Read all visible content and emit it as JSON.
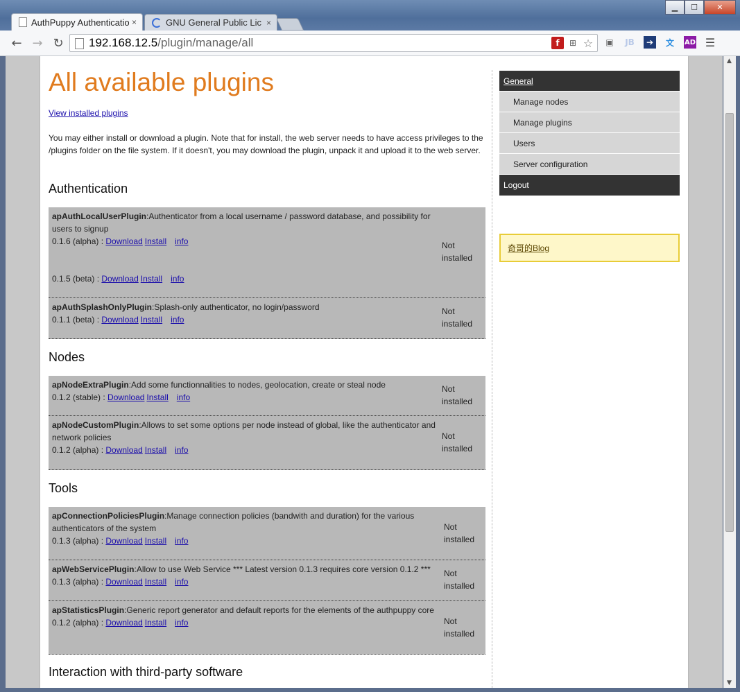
{
  "browser": {
    "tabs": [
      {
        "title": "AuthPuppy Authenticatio",
        "close": "×"
      },
      {
        "title": "GNU General Public Lic",
        "close": "×"
      }
    ],
    "url_host": "192.168.12.5",
    "url_path": "/plugin/manage/all",
    "nav": {
      "back": "←",
      "forward": "→",
      "reload": "↻"
    },
    "window": {
      "minimize": "▁",
      "maximize": "☐",
      "close": "✕"
    }
  },
  "page": {
    "title": "All available plugins",
    "view_installed_link": "View installed plugins",
    "intro": "You may either install or download a plugin. Note that for install, the web server needs to have access privileges to the /plugins folder on the file system. If it doesn't, you may download the plugin, unpack it and upload it to the web server.",
    "sections": [
      {
        "heading": "Authentication",
        "plugins": [
          {
            "name": "apAuthLocalUserPlugin",
            "desc": ":Authenticator from a local username / password database, and possibility for users to signup",
            "versions": [
              {
                "label": "0.1.6 (alpha) : ",
                "download": "Download",
                "install": "Install",
                "info": "info"
              },
              {
                "label": "0.1.5 (beta) : ",
                "download": "Download",
                "install": "Install",
                "info": "info"
              }
            ],
            "status": "Not installed"
          },
          {
            "name": "apAuthSplashOnlyPlugin",
            "desc": ":Splash-only authenticator, no login/password",
            "versions": [
              {
                "label": "0.1.1 (beta) : ",
                "download": "Download",
                "install": "Install",
                "info": "info"
              }
            ],
            "status": "Not installed"
          }
        ]
      },
      {
        "heading": "Nodes",
        "plugins": [
          {
            "name": "apNodeExtraPlugin",
            "desc": ":Add some functionnalities to nodes, geolocation, create or steal node",
            "versions": [
              {
                "label": "0.1.2 (stable) : ",
                "download": "Download",
                "install": "Install",
                "info": "info"
              }
            ],
            "status": "Not installed"
          },
          {
            "name": "apNodeCustomPlugin",
            "desc": ":Allows to set some options per node instead of global, like the authenticator and network policies",
            "versions": [
              {
                "label": "0.1.2 (alpha) : ",
                "download": "Download",
                "install": "Install",
                "info": "info"
              }
            ],
            "status": "Not installed"
          }
        ]
      },
      {
        "heading": "Tools",
        "plugins": [
          {
            "name": "apConnectionPoliciesPlugin",
            "desc": ":Manage connection policies (bandwith and duration) for the various authenticators of the system",
            "versions": [
              {
                "label": "0.1.3 (alpha) : ",
                "download": "Download",
                "install": "Install",
                "info": "info"
              }
            ],
            "status": "Not installed"
          },
          {
            "name": "apWebServicePlugin",
            "desc": ":Allow to use Web Service *** Latest version 0.1.3 requires core version 0.1.2 ***",
            "versions": [
              {
                "label": "0.1.3 (alpha) : ",
                "download": "Download",
                "install": "Install",
                "info": "info"
              }
            ],
            "status": "Not installed"
          },
          {
            "name": "apStatisticsPlugin",
            "desc": ":Generic report generator and default reports for the elements of the authpuppy core",
            "versions": [
              {
                "label": "0.1.2 (alpha) : ",
                "download": "Download",
                "install": "Install",
                "info": "info"
              }
            ],
            "status": "Not installed"
          }
        ]
      },
      {
        "heading": "Interaction with third-party software",
        "plugins": []
      }
    ]
  },
  "sidebar": {
    "general": "General",
    "items": [
      "Manage nodes",
      "Manage plugins",
      "Users",
      "Server configuration"
    ],
    "logout": "Logout",
    "blog_link": "奇哥的Blog"
  }
}
